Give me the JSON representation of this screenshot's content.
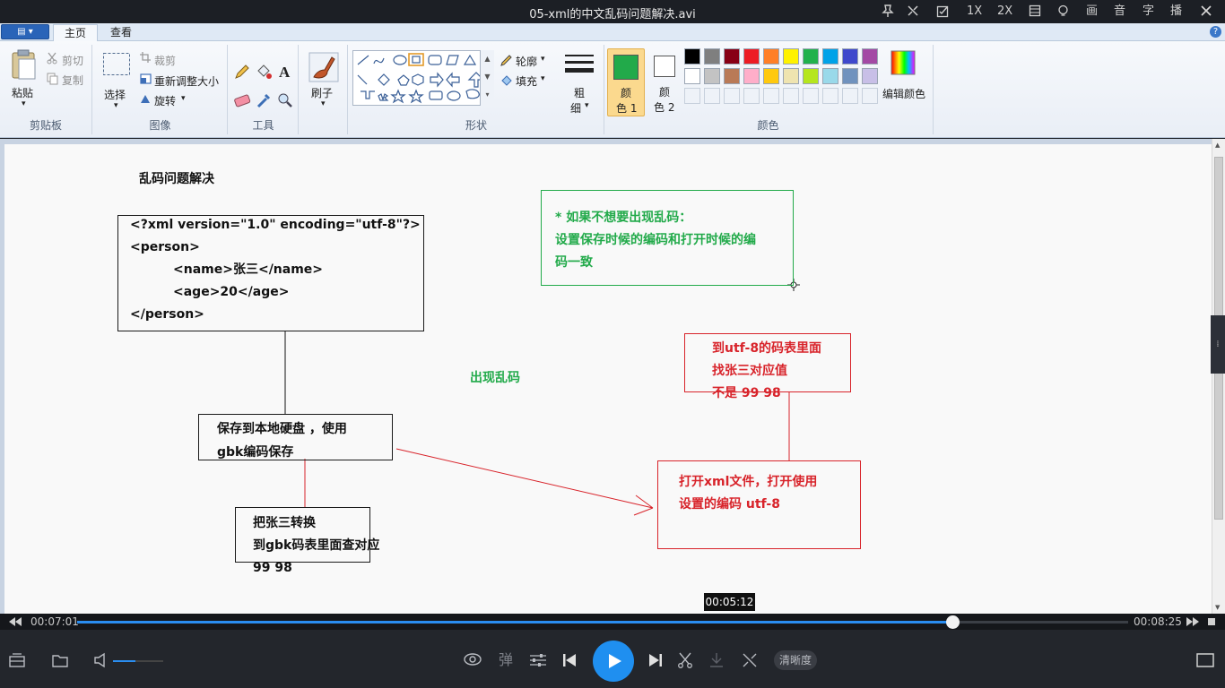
{
  "titlebar": {
    "title": "05-xml的中文乱码问题解决.avi",
    "controls": [
      "1X",
      "2X",
      "画",
      "音",
      "字",
      "播"
    ]
  },
  "ribbon": {
    "tabs": [
      "主页",
      "查看"
    ],
    "clipboard": {
      "paste": "粘贴",
      "cut": "剪切",
      "copy": "复制",
      "label": "剪贴板"
    },
    "image": {
      "select": "选择",
      "crop": "裁剪",
      "resize": "重新调整大小",
      "rotate": "旋转",
      "label": "图像"
    },
    "tools": {
      "label": "工具"
    },
    "brushes": {
      "label": "刷子"
    },
    "shapes": {
      "outline": "轮廓",
      "fill": "填充",
      "label": "形状"
    },
    "size": {
      "label_top": "粗",
      "label_bottom": "细"
    },
    "colors": {
      "color1_top": "颜",
      "color1_bottom": "色 1",
      "color2_top": "颜",
      "color2_bottom": "色 2",
      "edit": "编辑颜色",
      "label": "颜色",
      "color1": "#22aa4a",
      "color2": "#ffffff",
      "palette_row1": [
        "#000000",
        "#7f7f7f",
        "#880015",
        "#ed1c24",
        "#ff7f27",
        "#fff200",
        "#22b14c",
        "#00a2e8",
        "#3f48cc",
        "#a349a4"
      ],
      "palette_row2": [
        "#ffffff",
        "#c3c3c3",
        "#b97a57",
        "#ffaec9",
        "#ffc90e",
        "#efe4b0",
        "#b5e61d",
        "#99d9ea",
        "#7092be",
        "#c8bfe7"
      ]
    }
  },
  "canvas": {
    "title": "乱码问题解决",
    "xml_lines": [
      "<?xml version=\"1.0\" encoding=\"utf-8\"?>",
      "<person>",
      "<name>张三</name>",
      "<age>20</age>",
      "</person>"
    ],
    "save_box": [
      "保存到本地硬盘 ，使用",
      "gbk编码保存"
    ],
    "convert_box": [
      "把张三转换",
      "到gbk码表里面查对应",
      "99 98"
    ],
    "garbled_label": "出现乱码",
    "tip_box": [
      "* 如果不想要出现乱码：",
      "设置保存时候的编码和打开时候的编",
      "码一致"
    ],
    "utf8_box": [
      "到utf-8的码表里面",
      "找张三对应值",
      "不是 99 98"
    ],
    "open_box": [
      "打开xml文件，打开使用",
      "设置的编码 utf-8"
    ]
  },
  "player": {
    "hover_time": "00:05:12",
    "current_time": "00:07:01",
    "total_time": "00:08:25",
    "progress": 0.8327,
    "volume": 0.45,
    "danmaku": "弹",
    "clarity": "清晰度"
  }
}
